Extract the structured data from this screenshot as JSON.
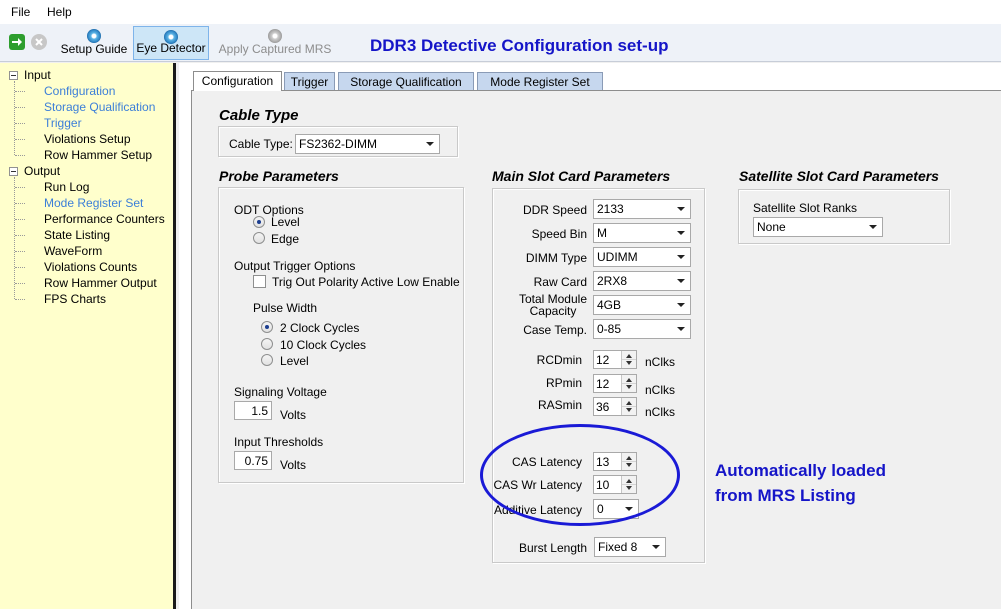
{
  "menu": {
    "file": "File",
    "help": "Help"
  },
  "toolbar": {
    "setup_guide": "Setup Guide",
    "eye_detector": "Eye Detector",
    "apply_mrs": "Apply Captured MRS",
    "title": "DDR3 Detective Configuration set-up"
  },
  "tree": {
    "input": "Input",
    "input_items": [
      "Configuration",
      "Storage Qualification",
      "Trigger",
      "Violations Setup",
      "Row Hammer Setup"
    ],
    "output": "Output",
    "output_items": [
      "Run Log",
      "Mode Register Set",
      "Performance Counters",
      "State Listing",
      "WaveForm",
      "Violations Counts",
      "Row Hammer Output",
      "FPS Charts"
    ]
  },
  "tabs": [
    "Configuration",
    "Trigger",
    "Storage Qualification",
    "Mode Register Set"
  ],
  "cable": {
    "heading": "Cable Type",
    "label": "Cable Type:",
    "value": "FS2362-DIMM"
  },
  "probe": {
    "heading": "Probe Parameters",
    "odt_label": "ODT Options",
    "odt_level": "Level",
    "odt_edge": "Edge",
    "trigger_label": "Output Trigger Options",
    "trig_polarity": "Trig Out Polarity Active Low Enable",
    "pulse_label": "Pulse Width",
    "pulse_2": "2 Clock Cycles",
    "pulse_10": "10 Clock Cycles",
    "pulse_level": "Level",
    "signal_label": "Signaling Voltage",
    "signal_value": "1.5",
    "signal_unit": "Volts",
    "input_label": "Input Thresholds",
    "input_value": "0.75",
    "input_unit": "Volts"
  },
  "main": {
    "heading": "Main Slot Card Parameters",
    "ddr_speed_label": "DDR Speed",
    "ddr_speed": "2133",
    "speed_bin_label": "Speed Bin",
    "speed_bin": "M",
    "dimm_type_label": "DIMM Type",
    "dimm_type": "UDIMM",
    "raw_card_label": "Raw Card",
    "raw_card": "2RX8",
    "capacity_label_1": "Total Module",
    "capacity_label_2": "Capacity",
    "capacity": "4GB",
    "case_temp_label": "Case Temp.",
    "case_temp": "0-85",
    "rcd_label": "RCDmin",
    "rcd": "12",
    "rp_label": "RPmin",
    "rp": "12",
    "ras_label": "RASmin",
    "ras": "36",
    "unit": "nClks",
    "cas_label": "CAS Latency",
    "cas": "13",
    "caswr_label": "CAS Wr Latency",
    "caswr": "10",
    "additive_label": "Additive Latency",
    "additive": "0",
    "burst_label": "Burst Length",
    "burst": "Fixed 8"
  },
  "satellite": {
    "heading": "Satellite Slot Card Parameters",
    "ranks_label": "Satellite Slot Ranks",
    "ranks": "None"
  },
  "annotation": {
    "line1": "Automatically loaded",
    "line2": "from MRS Listing"
  },
  "colors": {
    "tree_bg": "#ffffcc",
    "annotation": "#1515c8",
    "link": "#3c7fd8"
  }
}
